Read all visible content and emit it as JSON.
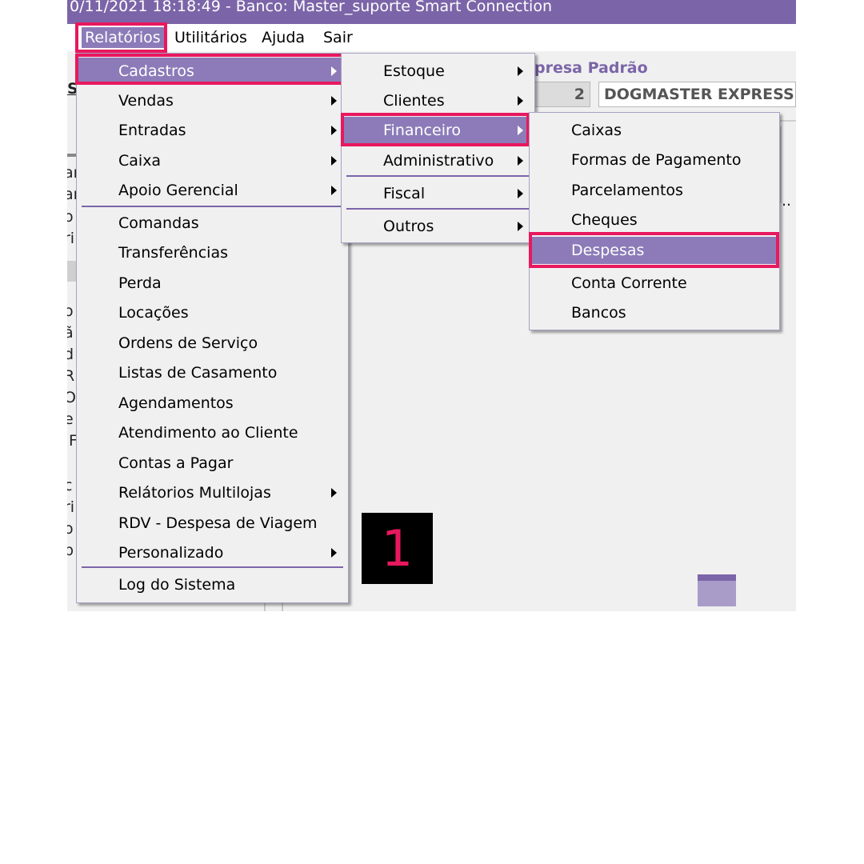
{
  "titlebar": {
    "text": "0/11/2021 18:18:49 - Banco: Master_suporte Smart Connection"
  },
  "menubar": {
    "items": [
      {
        "label": "Relatórios"
      },
      {
        "label": "Utilitários"
      },
      {
        "label": "Ajuda"
      },
      {
        "label": "Sair"
      }
    ]
  },
  "background": {
    "empresa_label": "presa Padrão",
    "empresa_code": "2",
    "empresa_name": "DOGMASTER EXPRESS",
    "left_fragments": [
      "S",
      "ar",
      "ar",
      "o",
      "ri",
      "o",
      "ã",
      "d",
      "R",
      "O",
      "e",
      "F",
      "c",
      "ri",
      "o",
      "p"
    ],
    "ellipsis": ".."
  },
  "menu_relatorios": {
    "items": [
      {
        "label": "Cadastros"
      },
      {
        "label": "Vendas"
      },
      {
        "label": "Entradas"
      },
      {
        "label": "Caixa"
      },
      {
        "label": "Apoio Gerencial"
      },
      {
        "label": "Comandas"
      },
      {
        "label": "Transferências"
      },
      {
        "label": "Perda"
      },
      {
        "label": "Locações"
      },
      {
        "label": "Ordens de Serviço"
      },
      {
        "label": "Listas de Casamento"
      },
      {
        "label": "Agendamentos"
      },
      {
        "label": "Atendimento ao Cliente"
      },
      {
        "label": "Contas a Pagar"
      },
      {
        "label": "Relátorios Multilojas"
      },
      {
        "label": "RDV - Despesa de Viagem"
      },
      {
        "label": "Personalizado"
      },
      {
        "label": "Log do Sistema"
      }
    ]
  },
  "menu_cadastros": {
    "items": [
      {
        "label": "Estoque"
      },
      {
        "label": "Clientes"
      },
      {
        "label": "Financeiro"
      },
      {
        "label": "Administrativo"
      },
      {
        "label": "Fiscal"
      },
      {
        "label": "Outros"
      }
    ]
  },
  "menu_financeiro": {
    "items": [
      {
        "label": "Caixas"
      },
      {
        "label": "Formas de Pagamento"
      },
      {
        "label": "Parcelamentos"
      },
      {
        "label": "Cheques"
      },
      {
        "label": "Despesas"
      },
      {
        "label": "Conta Corrente"
      },
      {
        "label": "Bancos"
      }
    ]
  },
  "step_badge": "1",
  "colors": {
    "accent": "#7b65a8",
    "selection": "#8c7bb8",
    "highlight": "#e8185f"
  }
}
